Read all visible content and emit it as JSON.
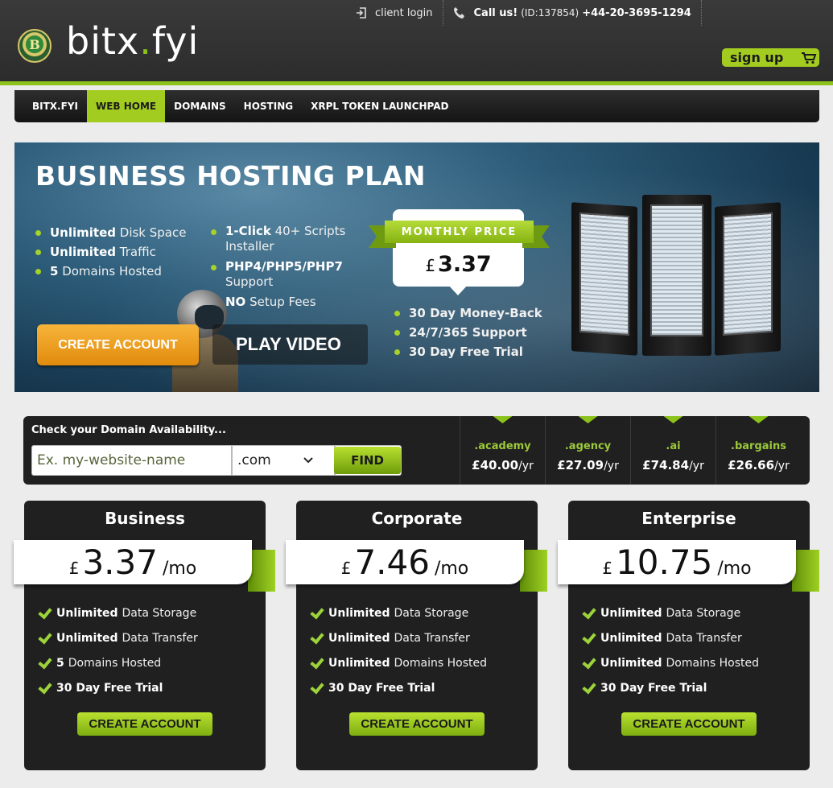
{
  "header": {
    "logo_text": "B",
    "brand_name": "bitx",
    "brand_dot": ".",
    "brand_tld": "fyi",
    "client_login": "client login",
    "call_label": "Call us!",
    "call_id": "(ID:137854)",
    "phone": "+44-20-3695-1294",
    "signup": "sign up"
  },
  "nav": {
    "items": [
      {
        "label": "BITX.FYI"
      },
      {
        "label": "WEB HOME"
      },
      {
        "label": "DOMAINS"
      },
      {
        "label": "HOSTING"
      },
      {
        "label": "XRPL TOKEN LAUNCHPAD"
      }
    ],
    "active_index": 1
  },
  "hero": {
    "title": "BUSINESS HOSTING PLAN",
    "features_col1": [
      {
        "bold": "Unlimited",
        "rest": " Disk Space"
      },
      {
        "bold": "Unlimited",
        "rest": " Traffic"
      },
      {
        "bold": "5",
        "rest": " Domains Hosted"
      }
    ],
    "features_col2": [
      {
        "bold": "1-Click",
        "rest": " 40+ Scripts Installer"
      },
      {
        "bold": "PHP4/PHP5/PHP7",
        "rest": " Support"
      },
      {
        "bold": "NO",
        "rest": " Setup Fees"
      }
    ],
    "features_col3": [
      "30 Day Money-Back",
      "24/7/365 Support",
      "30 Day Free Trial"
    ],
    "monthly_label": "MONTHLY PRICE",
    "currency": "£",
    "price": "3.37",
    "create_account": "CREATE ACCOUNT",
    "play_video": "PLAY VIDEO"
  },
  "domain_search": {
    "label": "Check your Domain Availability...",
    "placeholder": "Ex. my-website-name",
    "tld_selected": ".com",
    "find": "FIND",
    "tlds": [
      {
        "name": ".academy",
        "price": "£40.00",
        "unit": "/yr"
      },
      {
        "name": ".agency",
        "price": "£27.09",
        "unit": "/yr"
      },
      {
        "name": ".ai",
        "price": "£74.84",
        "unit": "/yr"
      },
      {
        "name": ".bargains",
        "price": "£26.66",
        "unit": "/yr"
      }
    ]
  },
  "plans": [
    {
      "title": "Business",
      "currency": "£",
      "amount": "3.37",
      "period": "/mo",
      "features": [
        {
          "bold": "Unlimited",
          "rest": " Data Storage"
        },
        {
          "bold": "Unlimited",
          "rest": " Data Transfer"
        },
        {
          "bold": "5",
          "rest": " Domains Hosted"
        },
        {
          "bold": "30 Day Free Trial",
          "rest": ""
        }
      ],
      "button": "CREATE ACCOUNT"
    },
    {
      "title": "Corporate",
      "currency": "£",
      "amount": "7.46",
      "period": "/mo",
      "features": [
        {
          "bold": "Unlimited",
          "rest": " Data Storage"
        },
        {
          "bold": "Unlimited",
          "rest": " Data Transfer"
        },
        {
          "bold": "Unlimited",
          "rest": " Domains Hosted"
        },
        {
          "bold": "30 Day Free Trial",
          "rest": ""
        }
      ],
      "button": "CREATE ACCOUNT"
    },
    {
      "title": "Enterprise",
      "currency": "£",
      "amount": "10.75",
      "period": "/mo",
      "features": [
        {
          "bold": "Unlimited",
          "rest": " Data Storage"
        },
        {
          "bold": "Unlimited",
          "rest": " Data Transfer"
        },
        {
          "bold": "Unlimited",
          "rest": " Domains Hosted"
        },
        {
          "bold": "30 Day Free Trial",
          "rest": ""
        }
      ],
      "button": "CREATE ACCOUNT"
    }
  ],
  "colors": {
    "accent": "#a3cc20",
    "orange": "#f0a020",
    "dark": "#202020"
  },
  "icons": {
    "login": "login-icon",
    "phone": "phone-icon",
    "cart": "cart-icon",
    "check": "check-icon",
    "chevron": "chevron-down-icon"
  }
}
